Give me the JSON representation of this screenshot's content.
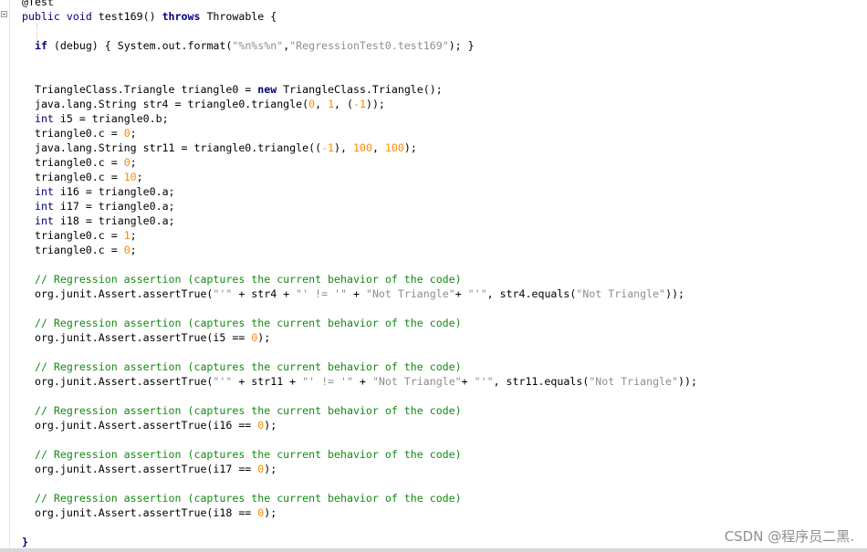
{
  "editor": {
    "lines": [
      [
        {
          "t": "@Test",
          "c": "plain"
        }
      ],
      [
        {
          "t": "public",
          "c": "kt"
        },
        {
          "t": " ",
          "c": "plain"
        },
        {
          "t": "void",
          "c": "kt"
        },
        {
          "t": " test169() ",
          "c": "plain"
        },
        {
          "t": "throws",
          "c": "kw"
        },
        {
          "t": " Throwable {",
          "c": "plain"
        }
      ],
      [],
      [
        {
          "t": "  ",
          "c": "plain"
        },
        {
          "t": "if",
          "c": "kw"
        },
        {
          "t": " (debug) { System.out.format(",
          "c": "plain"
        },
        {
          "t": "\"%n%s%n\"",
          "c": "str"
        },
        {
          "t": ",",
          "c": "plain"
        },
        {
          "t": "\"RegressionTest0.test169\"",
          "c": "str"
        },
        {
          "t": "); }",
          "c": "plain"
        }
      ],
      [],
      [],
      [
        {
          "t": "  TriangleClass.Triangle triangle0 = ",
          "c": "plain"
        },
        {
          "t": "new",
          "c": "kw"
        },
        {
          "t": " TriangleClass.Triangle();",
          "c": "plain"
        }
      ],
      [
        {
          "t": "  java.lang.String str4 = triangle0.triangle(",
          "c": "plain"
        },
        {
          "t": "0",
          "c": "num"
        },
        {
          "t": ", ",
          "c": "plain"
        },
        {
          "t": "1",
          "c": "num"
        },
        {
          "t": ", (",
          "c": "plain"
        },
        {
          "t": "-1",
          "c": "num"
        },
        {
          "t": "));",
          "c": "plain"
        }
      ],
      [
        {
          "t": "  ",
          "c": "plain"
        },
        {
          "t": "int",
          "c": "kt"
        },
        {
          "t": " i5 = triangle0.b;",
          "c": "plain"
        }
      ],
      [
        {
          "t": "  triangle0.c = ",
          "c": "plain"
        },
        {
          "t": "0",
          "c": "num"
        },
        {
          "t": ";",
          "c": "plain"
        }
      ],
      [
        {
          "t": "  java.lang.String str11 = triangle0.triangle((",
          "c": "plain"
        },
        {
          "t": "-1",
          "c": "num"
        },
        {
          "t": "), ",
          "c": "plain"
        },
        {
          "t": "100",
          "c": "num"
        },
        {
          "t": ", ",
          "c": "plain"
        },
        {
          "t": "100",
          "c": "num"
        },
        {
          "t": ");",
          "c": "plain"
        }
      ],
      [
        {
          "t": "  triangle0.c = ",
          "c": "plain"
        },
        {
          "t": "0",
          "c": "num"
        },
        {
          "t": ";",
          "c": "plain"
        }
      ],
      [
        {
          "t": "  triangle0.c = ",
          "c": "plain"
        },
        {
          "t": "10",
          "c": "num"
        },
        {
          "t": ";",
          "c": "plain"
        }
      ],
      [
        {
          "t": "  ",
          "c": "plain"
        },
        {
          "t": "int",
          "c": "kt"
        },
        {
          "t": " i16 = triangle0.a;",
          "c": "plain"
        }
      ],
      [
        {
          "t": "  ",
          "c": "plain"
        },
        {
          "t": "int",
          "c": "kt"
        },
        {
          "t": " i17 = triangle0.a;",
          "c": "plain"
        }
      ],
      [
        {
          "t": "  ",
          "c": "plain"
        },
        {
          "t": "int",
          "c": "kt"
        },
        {
          "t": " i18 = triangle0.a;",
          "c": "plain"
        }
      ],
      [
        {
          "t": "  triangle0.c = ",
          "c": "plain"
        },
        {
          "t": "1",
          "c": "num"
        },
        {
          "t": ";",
          "c": "plain"
        }
      ],
      [
        {
          "t": "  triangle0.c = ",
          "c": "plain"
        },
        {
          "t": "0",
          "c": "num"
        },
        {
          "t": ";",
          "c": "plain"
        }
      ],
      [],
      [
        {
          "t": "  // Regression assertion (captures the current behavior of the code)",
          "c": "cm"
        }
      ],
      [
        {
          "t": "  org.junit.Assert.assertTrue(",
          "c": "plain"
        },
        {
          "t": "\"'\"",
          "c": "str"
        },
        {
          "t": " + str4 + ",
          "c": "plain"
        },
        {
          "t": "\"' != '\"",
          "c": "str"
        },
        {
          "t": " + ",
          "c": "plain"
        },
        {
          "t": "\"Not Triangle\"",
          "c": "str"
        },
        {
          "t": "+ ",
          "c": "plain"
        },
        {
          "t": "\"'\"",
          "c": "str"
        },
        {
          "t": ", str4.equals(",
          "c": "plain"
        },
        {
          "t": "\"Not Triangle\"",
          "c": "str"
        },
        {
          "t": "));",
          "c": "plain"
        }
      ],
      [],
      [
        {
          "t": "  // Regression assertion (captures the current behavior of the code)",
          "c": "cm"
        }
      ],
      [
        {
          "t": "  org.junit.Assert.assertTrue(i5 == ",
          "c": "plain"
        },
        {
          "t": "0",
          "c": "num"
        },
        {
          "t": ");",
          "c": "plain"
        }
      ],
      [],
      [
        {
          "t": "  // Regression assertion (captures the current behavior of the code)",
          "c": "cm"
        }
      ],
      [
        {
          "t": "  org.junit.Assert.assertTrue(",
          "c": "plain"
        },
        {
          "t": "\"'\"",
          "c": "str"
        },
        {
          "t": " + str11 + ",
          "c": "plain"
        },
        {
          "t": "\"' != '\"",
          "c": "str"
        },
        {
          "t": " + ",
          "c": "plain"
        },
        {
          "t": "\"Not Triangle\"",
          "c": "str"
        },
        {
          "t": "+ ",
          "c": "plain"
        },
        {
          "t": "\"'\"",
          "c": "str"
        },
        {
          "t": ", str11.equals(",
          "c": "plain"
        },
        {
          "t": "\"Not Triangle\"",
          "c": "str"
        },
        {
          "t": "));",
          "c": "plain"
        }
      ],
      [],
      [
        {
          "t": "  // Regression assertion (captures the current behavior of the code)",
          "c": "cm"
        }
      ],
      [
        {
          "t": "  org.junit.Assert.assertTrue(i16 == ",
          "c": "plain"
        },
        {
          "t": "0",
          "c": "num"
        },
        {
          "t": ");",
          "c": "plain"
        }
      ],
      [],
      [
        {
          "t": "  // Regression assertion (captures the current behavior of the code)",
          "c": "cm"
        }
      ],
      [
        {
          "t": "  org.junit.Assert.assertTrue(i17 == ",
          "c": "plain"
        },
        {
          "t": "0",
          "c": "num"
        },
        {
          "t": ");",
          "c": "plain"
        }
      ],
      [],
      [
        {
          "t": "  // Regression assertion (captures the current behavior of the code)",
          "c": "cm"
        }
      ],
      [
        {
          "t": "  org.junit.Assert.assertTrue(i18 == ",
          "c": "plain"
        },
        {
          "t": "0",
          "c": "num"
        },
        {
          "t": ");",
          "c": "plain"
        }
      ],
      [],
      [
        {
          "t": "}",
          "c": "kw"
        }
      ]
    ]
  },
  "watermark": "CSDN @程序员二黑.",
  "icons": {
    "fold_marker": "collapse-fold-icon"
  },
  "colors": {
    "keyword": "#00007a",
    "string": "#8e8e8e",
    "number": "#ff8a00",
    "comment": "#138a13"
  }
}
